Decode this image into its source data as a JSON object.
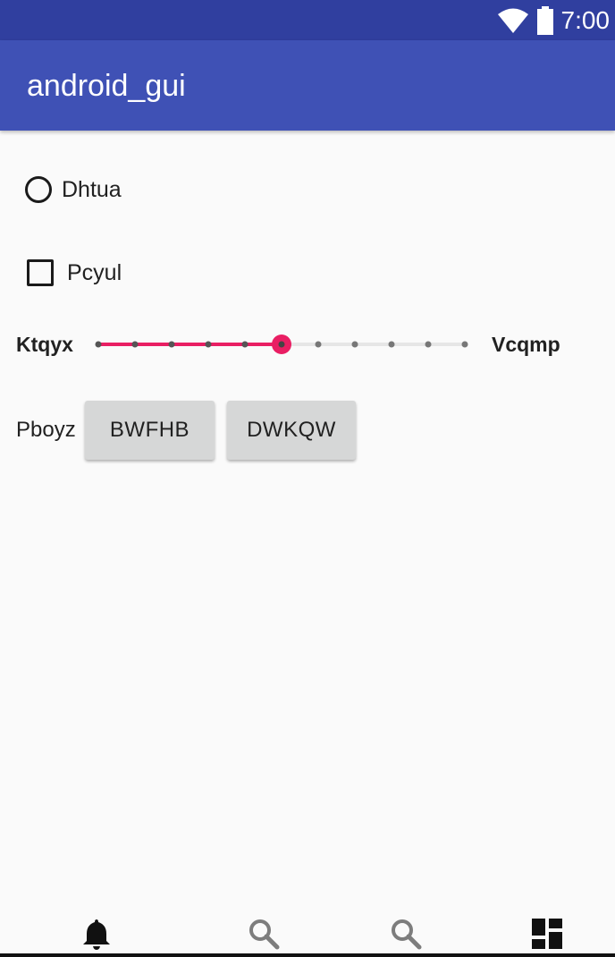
{
  "status_bar": {
    "time": "7:00",
    "wifi_icon": "wifi-icon",
    "battery_icon": "battery-icon"
  },
  "app_bar": {
    "title": "android_gui"
  },
  "radio": {
    "label": "Dhtua",
    "checked": false
  },
  "checkbox": {
    "label": "Pcyul",
    "checked": false
  },
  "slider": {
    "left_label": "Ktqyx",
    "right_label": "Vcqmp",
    "steps": 10,
    "value": 5,
    "accent_color": "#e91e63"
  },
  "button_group": {
    "label": "Pboyz",
    "buttons": [
      "BWFHB",
      "DWKQW"
    ]
  },
  "bottom_nav": {
    "items": [
      {
        "icon": "bell-icon",
        "active": true
      },
      {
        "icon": "search-icon",
        "active": false
      },
      {
        "icon": "search-icon",
        "active": false
      },
      {
        "icon": "dashboard-icon",
        "active": false
      }
    ]
  }
}
